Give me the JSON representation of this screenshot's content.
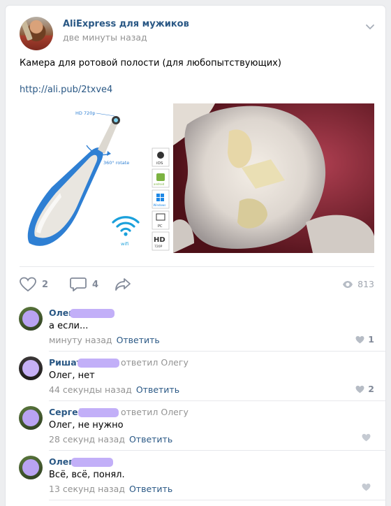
{
  "post": {
    "group_name": "AliExpress для мужиков",
    "time": "две минуты назад",
    "text": "Камера для ротовой полости (для любопытствующих)",
    "link": "http://ali.pub/2txve4",
    "product_image": {
      "hd_label": "HD 720p",
      "rotate_label": "360° rotate",
      "wifi_label": "wifi",
      "platforms": [
        "iOS",
        "android",
        "Windows",
        "PC",
        "HD 720P"
      ]
    }
  },
  "actions": {
    "likes": "2",
    "comments": "4",
    "views": "813"
  },
  "comments": [
    {
      "name": "Олег",
      "reply_to": "",
      "text": "а если...",
      "time": "минуту назад",
      "reply_label": "Ответить",
      "likes": "1"
    },
    {
      "name": "Ришат",
      "reply_to": "ответил Олегу",
      "text": "Олег, нет",
      "time": "44 секунды назад",
      "reply_label": "Ответить",
      "likes": "2"
    },
    {
      "name": "Сергей",
      "reply_to": "ответил Олегу",
      "text": "Олег, не нужно",
      "time": "28 секунд назад",
      "reply_label": "Ответить",
      "likes": ""
    },
    {
      "name": "Олег",
      "reply_to": "",
      "text": "Всё, всё, понял.",
      "time": "13 секунд назад",
      "reply_label": "Ответить",
      "likes": ""
    }
  ],
  "colors": {
    "link": "#2a5885",
    "muted": "#939393",
    "redaction": "#c2aff8",
    "icon": "#828a99"
  }
}
